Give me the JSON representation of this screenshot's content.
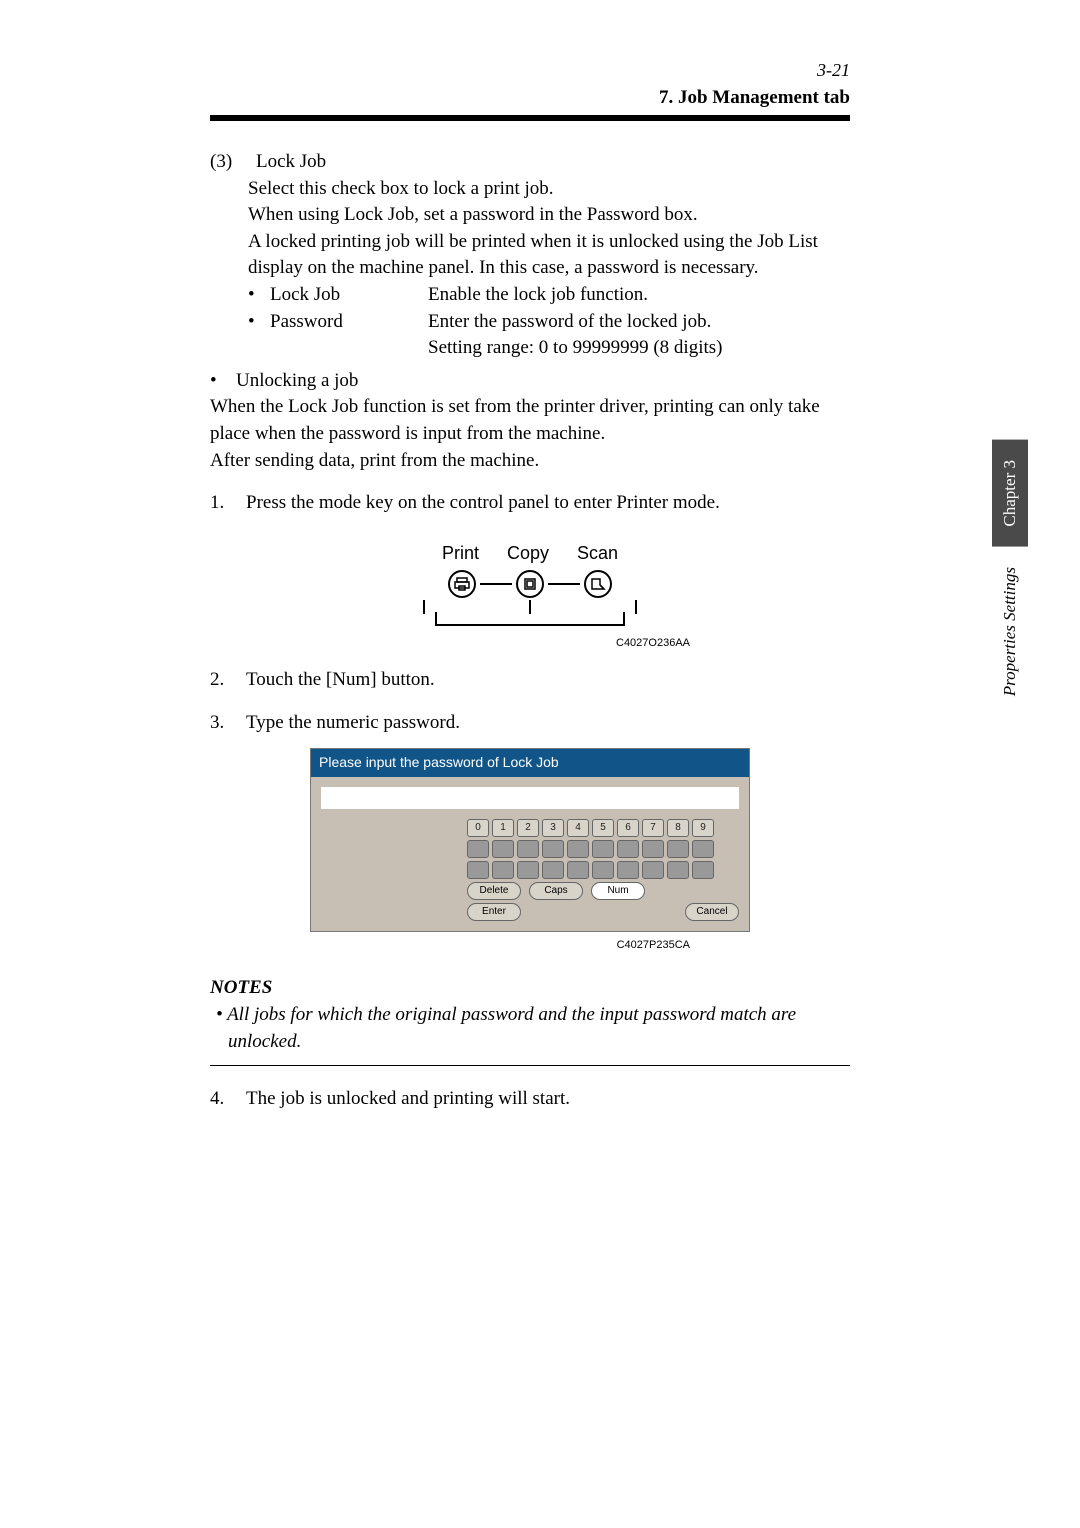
{
  "page_number": "3-21",
  "section_title": "7. Job Management tab",
  "lock_job": {
    "number": "(3)",
    "title": "Lock Job",
    "desc1": "Select this check box to lock a print job.",
    "desc2": "When using Lock Job, set a password in the Password box.",
    "desc3": "A locked printing job will be printed when it is unlocked using the Job List display on the machine panel. In this case, a password is necessary.",
    "sub1_label": "Lock Job",
    "sub1_desc": "Enable the lock job function.",
    "sub2_label": "Password",
    "sub2_desc": "Enter the password of the locked job.",
    "sub2_desc2": "Setting range: 0 to 99999999 (8 digits)"
  },
  "unlocking": {
    "title": "Unlocking a job",
    "para1": "When the Lock Job function is set from the printer driver, printing can only take place when the password is input from the machine.",
    "para2": "After sending data, print from the machine."
  },
  "steps": {
    "s1_num": "1.",
    "s1_text": "Press the mode key on the control panel to enter Printer mode.",
    "s2_num": "2.",
    "s2_text": "Touch the [Num] button.",
    "s3_num": "3.",
    "s3_text": "Type the numeric password.",
    "s4_num": "4.",
    "s4_text": "The job is unlocked and printing will start."
  },
  "panel": {
    "print": "Print",
    "copy": "Copy",
    "scan": "Scan",
    "code": "C4027O236AA"
  },
  "keypad": {
    "title": "Please input the password of Lock Job",
    "keys": [
      "0",
      "1",
      "2",
      "3",
      "4",
      "5",
      "6",
      "7",
      "8",
      "9"
    ],
    "delete": "Delete",
    "caps": "Caps",
    "num": "Num",
    "enter": "Enter",
    "cancel": "Cancel",
    "code": "C4027P235CA"
  },
  "notes": {
    "header": "NOTES",
    "bullet": "•",
    "text": "All jobs for which the original password and the input password match are unlocked."
  },
  "side": {
    "chapter": "Chapter 3",
    "label": "Properties Settings"
  }
}
